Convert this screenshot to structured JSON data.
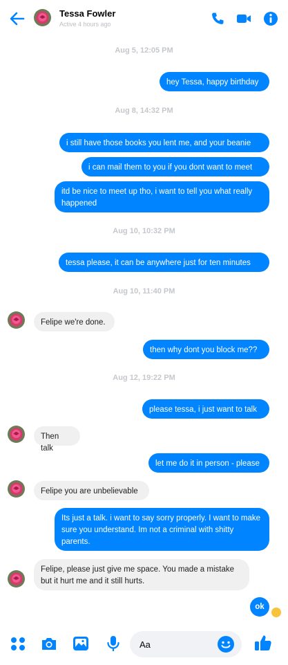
{
  "header": {
    "name": "Tessa Fowler",
    "status": "Active 4 hours ago",
    "back_icon": "arrow-left-icon",
    "call_icon": "phone-icon",
    "video_icon": "video-camera-icon",
    "info_icon": "info-icon"
  },
  "colors": {
    "accent": "#0084ff",
    "incoming": "#f0f0f0",
    "timestamp": "#c4c7cc"
  },
  "timestamps": [
    "Aug 5, 12:05 PM",
    "Aug 8, 14:32 PM",
    "Aug 10, 10:32 PM",
    "Aug 10, 11:40 PM",
    "Aug 12, 19:22 PM"
  ],
  "messages": [
    {
      "dir": "out",
      "text": "hey Tessa, happy birthday"
    },
    {
      "dir": "out",
      "text": "i still have those books you lent me, and your beanie"
    },
    {
      "dir": "out",
      "text": "i can mail them to you if you dont want to meet"
    },
    {
      "dir": "out",
      "text": "itd be nice to meet up tho, i want to tell you what really happened"
    },
    {
      "dir": "out",
      "text": "tessa please, it can be anywhere just for ten minutes"
    },
    {
      "dir": "in",
      "text": "Felipe we're done."
    },
    {
      "dir": "out",
      "text": "then why dont you block me??"
    },
    {
      "dir": "out",
      "text": "please tessa, i just want to talk"
    },
    {
      "dir": "in",
      "text": "Then talk"
    },
    {
      "dir": "out",
      "text": "let me do it in person - please"
    },
    {
      "dir": "in",
      "text": "Felipe you are unbelievable"
    },
    {
      "dir": "out",
      "text": "Its just a talk. i want to say sorry properly. I want to make sure you understand. Im not a criminal with shitty parents."
    },
    {
      "dir": "in",
      "text": "Felipe, please just give me space. You made a mistake but it hurt me and it still hurts."
    },
    {
      "dir": "out",
      "text": "ok"
    }
  ],
  "composer": {
    "placeholder": "Aa",
    "apps_icon": "apps-grid-icon",
    "camera_icon": "camera-icon",
    "gallery_icon": "image-gallery-icon",
    "mic_icon": "microphone-icon",
    "emoji_icon": "smiley-emoji-icon",
    "like_icon": "thumbs-up-icon"
  }
}
